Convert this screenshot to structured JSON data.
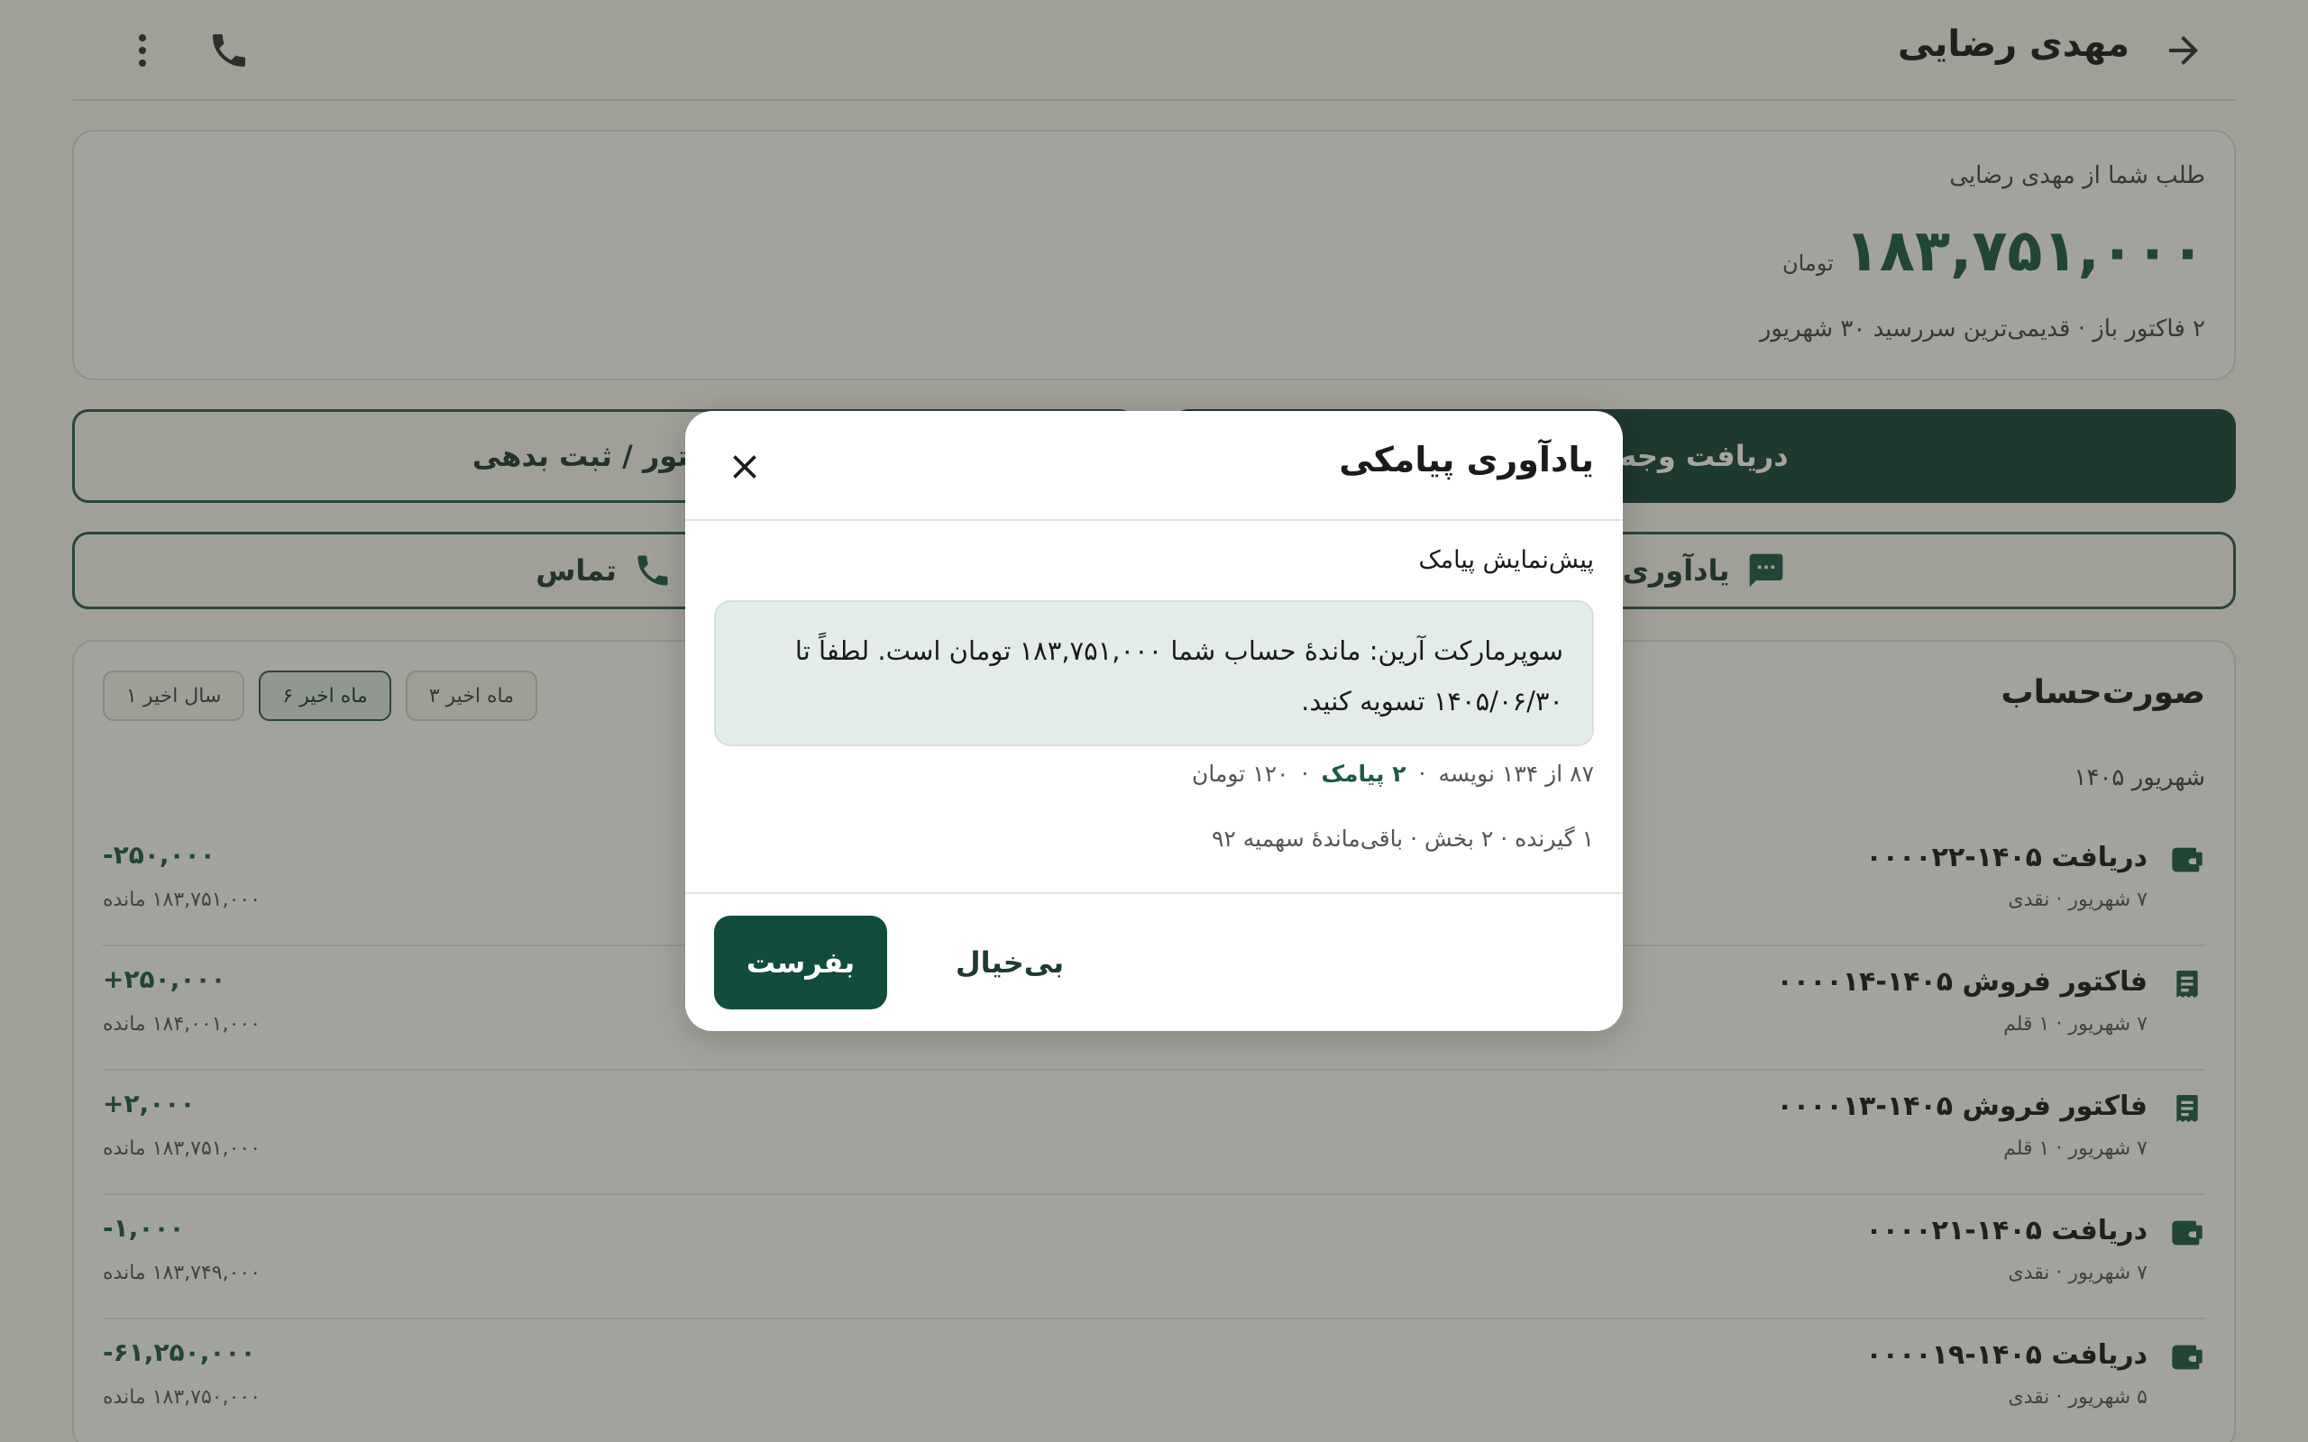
{
  "header": {
    "title": "مهدی رضایی",
    "back_icon": "arrow-forward-icon",
    "phone_icon": "phone-icon",
    "more_icon": "more-vert-icon"
  },
  "balance": {
    "label": "طلب شما از مهدی رضایی",
    "amount": "۱۸۳,۷۵۱,۰۰۰",
    "currency": "تومان",
    "summary": "۲ فاکتور باز · قدیمی‌ترین سررسید ۳۰ شهریور"
  },
  "actions": {
    "receive_payment": "دریافت وجه",
    "invoice_debt": "فاکتور / ثبت بدهی",
    "reminder": "یادآوری",
    "call": "تماس"
  },
  "statement": {
    "title": "صورت‌حساب",
    "filters": [
      "۱ سال اخیر",
      "۶ ماه اخیر",
      "۳ ماه اخیر"
    ],
    "active_filter": "۶ ماه اخیر",
    "month": "شهریور ۱۴۰۵",
    "transactions": [
      {
        "title": "دریافت ۱۴۰۵-۰۰۰۰۲۲",
        "sub": "۷ شهریور · نقدی",
        "amount": "-۲۵۰,۰۰۰",
        "remain": "۱۸۳,۷۵۱,۰۰۰ مانده",
        "icon": "cash-icon"
      },
      {
        "title": "فاکتور فروش ۱۴۰۵-۰۰۰۰۱۴",
        "sub": "۷ شهریور · ۱ قلم",
        "amount": "+۲۵۰,۰۰۰",
        "remain": "۱۸۴,۰۰۱,۰۰۰ مانده",
        "icon": "receipt-icon"
      },
      {
        "title": "فاکتور فروش ۱۴۰۵-۰۰۰۰۱۳",
        "sub": "۷ شهریور · ۱ قلم",
        "amount": "+۲,۰۰۰",
        "remain": "۱۸۳,۷۵۱,۰۰۰ مانده",
        "icon": "receipt-icon"
      },
      {
        "title": "دریافت ۱۴۰۵-۰۰۰۰۲۱",
        "sub": "۷ شهریور · نقدی",
        "amount": "-۱,۰۰۰",
        "remain": "۱۸۳,۷۴۹,۰۰۰ مانده",
        "icon": "cash-icon"
      },
      {
        "title": "دریافت ۱۴۰۵-۰۰۰۰۱۹",
        "sub": "۵ شهریور · نقدی",
        "amount": "-۶۱,۲۵۰,۰۰۰",
        "remain": "۱۸۳,۷۵۰,۰۰۰ مانده",
        "icon": "cash-icon"
      }
    ]
  },
  "modal": {
    "title": "یادآوری پیامکی",
    "close_icon": "close-icon",
    "preview_label": "پیش‌نمایش پیامک",
    "preview_text": "سوپرمارکت آرین: ماندهٔ حساب شما ۱۸۳,۷۵۱,۰۰۰ تومان است. لطفاً تا ۱۴۰۵/۰۶/۳۰ تسویه کنید.",
    "char_count": "۸۷ از ۱۳۴ نویسه",
    "sms_count": "۲ پیامک",
    "cost": "۱۲۰ تومان",
    "recipients": "۱ گیرنده · ۲ بخش · باقی‌ماندهٔ سهمیه ۹۲",
    "send": "بفرست",
    "cancel": "بی‌خیال"
  },
  "colors": {
    "primary": "#17453a",
    "accent_green": "#1d5a47",
    "preview_bg": "#e3ece7"
  }
}
